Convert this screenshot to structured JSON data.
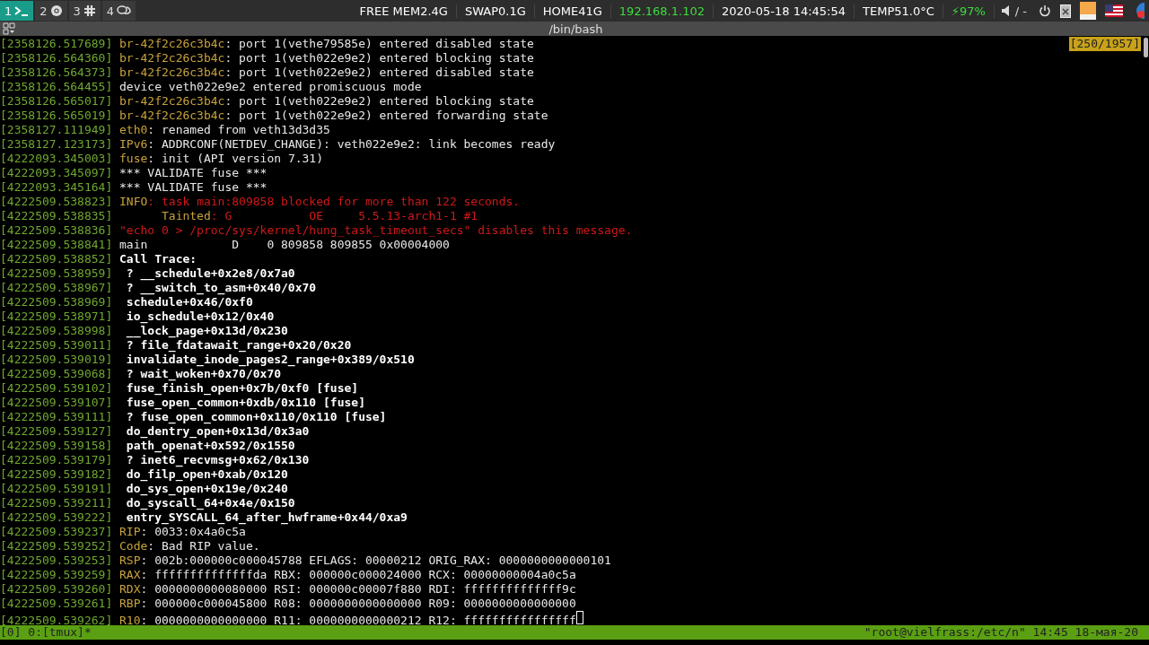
{
  "workspaces": [
    {
      "number": "1",
      "kind": "terminal",
      "selected": true
    },
    {
      "number": "2",
      "kind": "browser",
      "selected": false
    },
    {
      "number": "3",
      "kind": "hash",
      "selected": false
    },
    {
      "number": "4",
      "kind": "chat",
      "selected": false
    }
  ],
  "status": [
    {
      "text": "FREE MEM2.4G",
      "color": "#ffffff"
    },
    {
      "text": "SWAP0.1G",
      "color": "#ffffff"
    },
    {
      "text": "HOME41G",
      "color": "#ffffff"
    },
    {
      "text": "192.168.1.102",
      "color": "#3ddc3d"
    },
    {
      "text": "2020-05-18 14:45:54",
      "color": "#ffffff"
    },
    {
      "text": "TEMP51.0°C",
      "color": "#ffffff"
    },
    {
      "text": "⚡97%",
      "color": "#3ddc3d"
    }
  ],
  "volume": "/ -",
  "window": {
    "title": "/bin/bash"
  },
  "scroll_position": "[250/1957]",
  "log": [
    {
      "ts": "[2358126.517689]",
      "source": "br-42f2c26c3b4c",
      "text": ": port 1(vethe79585e) entered disabled state",
      "kind": "plain"
    },
    {
      "ts": "[2358126.564360]",
      "source": "br-42f2c26c3b4c",
      "text": ": port 1(veth022e9e2) entered blocking state",
      "kind": "plain"
    },
    {
      "ts": "[2358126.564373]",
      "source": "br-42f2c26c3b4c",
      "text": ": port 1(veth022e9e2) entered disabled state",
      "kind": "plain"
    },
    {
      "ts": "[2358126.564455]",
      "text": "device veth022e9e2 entered promiscuous mode",
      "kind": "plain"
    },
    {
      "ts": "[2358126.565017]",
      "source": "br-42f2c26c3b4c",
      "text": ": port 1(veth022e9e2) entered blocking state",
      "kind": "plain"
    },
    {
      "ts": "[2358126.565019]",
      "source": "br-42f2c26c3b4c",
      "text": ": port 1(veth022e9e2) entered forwarding state",
      "kind": "plain"
    },
    {
      "ts": "[2358127.111949]",
      "source": "eth0",
      "text": ": renamed from veth13d3d35",
      "kind": "plain"
    },
    {
      "ts": "[2358127.123173]",
      "source": "IPv6",
      "text": ": ADDRCONF(NETDEV_CHANGE): veth022e9e2: link becomes ready",
      "kind": "plain"
    },
    {
      "ts": "[4222093.345003]",
      "source": "fuse",
      "text": ": init (API version 7.31)",
      "kind": "plain"
    },
    {
      "ts": "[4222093.345097]",
      "text": "*** VALIDATE fuse ***",
      "kind": "plain"
    },
    {
      "ts": "[4222093.345164]",
      "text": "*** VALIDATE fuse ***",
      "kind": "plain"
    },
    {
      "ts": "[4222509.538823]",
      "source": "INFO",
      "text": ": task main:809858 blocked for more than 122 seconds.",
      "kind": "error"
    },
    {
      "ts": "[4222509.538835]",
      "source": "      Tainted",
      "text": ": G           OE     5.5.13-arch1-1 #1",
      "kind": "error"
    },
    {
      "ts": "[4222509.538836]",
      "text": "\"echo 0 > /proc/sys/kernel/hung_task_timeout_secs\" disables this message.",
      "kind": "error"
    },
    {
      "ts": "[4222509.538841]",
      "text": "main            D    0 809858 809855 0x00004000",
      "kind": "plain"
    },
    {
      "ts": "[4222509.538852]",
      "text": "Call Trace:",
      "kind": "bold"
    },
    {
      "ts": "[4222509.538959]",
      "text": " ? __schedule+0x2e8/0x7a0",
      "kind": "bold"
    },
    {
      "ts": "[4222509.538967]",
      "text": " ? __switch_to_asm+0x40/0x70",
      "kind": "bold"
    },
    {
      "ts": "[4222509.538969]",
      "text": " schedule+0x46/0xf0",
      "kind": "bold"
    },
    {
      "ts": "[4222509.538971]",
      "text": " io_schedule+0x12/0x40",
      "kind": "bold"
    },
    {
      "ts": "[4222509.538998]",
      "text": " __lock_page+0x13d/0x230",
      "kind": "bold"
    },
    {
      "ts": "[4222509.539011]",
      "text": " ? file_fdatawait_range+0x20/0x20",
      "kind": "bold"
    },
    {
      "ts": "[4222509.539019]",
      "text": " invalidate_inode_pages2_range+0x389/0x510",
      "kind": "bold"
    },
    {
      "ts": "[4222509.539068]",
      "text": " ? wait_woken+0x70/0x70",
      "kind": "bold"
    },
    {
      "ts": "[4222509.539102]",
      "text": " fuse_finish_open+0x7b/0xf0 [fuse]",
      "kind": "bold"
    },
    {
      "ts": "[4222509.539107]",
      "text": " fuse_open_common+0xdb/0x110 [fuse]",
      "kind": "bold"
    },
    {
      "ts": "[4222509.539111]",
      "text": " ? fuse_open_common+0x110/0x110 [fuse]",
      "kind": "bold"
    },
    {
      "ts": "[4222509.539127]",
      "text": " do_dentry_open+0x13d/0x3a0",
      "kind": "bold"
    },
    {
      "ts": "[4222509.539158]",
      "text": " path_openat+0x592/0x1550",
      "kind": "bold"
    },
    {
      "ts": "[4222509.539179]",
      "text": " ? inet6_recvmsg+0x62/0x130",
      "kind": "bold"
    },
    {
      "ts": "[4222509.539182]",
      "text": " do_filp_open+0xab/0x120",
      "kind": "bold"
    },
    {
      "ts": "[4222509.539191]",
      "text": " do_sys_open+0x19e/0x240",
      "kind": "bold"
    },
    {
      "ts": "[4222509.539211]",
      "text": " do_syscall_64+0x4e/0x150",
      "kind": "bold"
    },
    {
      "ts": "[4222509.539222]",
      "text": " entry_SYSCALL_64_after_hwframe+0x44/0xa9",
      "kind": "bold"
    },
    {
      "ts": "[4222509.539237]",
      "source": "RIP",
      "text": ": 0033:0x4a0c5a",
      "kind": "plain"
    },
    {
      "ts": "[4222509.539252]",
      "source": "Code",
      "text": ": Bad RIP value.",
      "kind": "plain"
    },
    {
      "ts": "[4222509.539253]",
      "source": "RSP",
      "text": ": 002b:000000c000045788 EFLAGS: 00000212 ORIG_RAX: 0000000000000101",
      "kind": "plain"
    },
    {
      "ts": "[4222509.539259]",
      "source": "RAX",
      "text": ": ffffffffffffffda RBX: 000000c000024000 RCX: 00000000004a0c5a",
      "kind": "plain"
    },
    {
      "ts": "[4222509.539260]",
      "source": "RDX",
      "text": ": 0000000000080000 RSI: 000000c00007f880 RDI: ffffffffffffff9c",
      "kind": "plain"
    },
    {
      "ts": "[4222509.539261]",
      "source": "RBP",
      "text": ": 000000c000045800 R08: 0000000000000000 R09: 0000000000000000",
      "kind": "plain"
    },
    {
      "ts": "[4222509.539262]",
      "source": "R10",
      "text": ": 0000000000000000 R11: 0000000000000212 R12: ffffffffffffffff",
      "kind": "plain",
      "cursor": true
    }
  ],
  "tmux": {
    "windows": "[0] 0:[tmux]*",
    "right": "\"root@vielfrass:/etc/n\" 14:45 18-мая-20"
  }
}
